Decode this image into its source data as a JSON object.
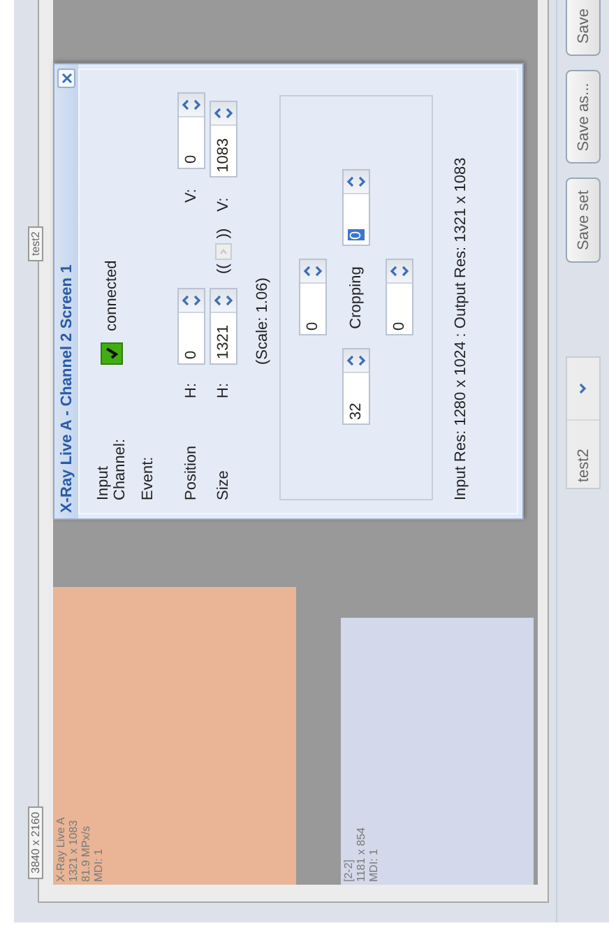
{
  "canvas_frame": {
    "size_tag": "3840 x 2160",
    "layout_tag": "test2"
  },
  "canvas": {
    "blocks": [
      {
        "lines": [
          "X-Ray Live A",
          "1321 x 1083",
          "81.9 MPx/s",
          "MDI: 1"
        ],
        "color": "#e9b596"
      },
      {
        "lines": [
          "[2-2]",
          "1181 x 854",
          "MDI: 1"
        ],
        "color": "#d3d8ea"
      }
    ]
  },
  "dialog": {
    "title": "X-Ray Live A - Channel 2 Screen 1",
    "input_channel": {
      "label": "Input Channel:",
      "status": "connected",
      "checked": true
    },
    "event": {
      "label": "Event:"
    },
    "position": {
      "label": "Position",
      "h_label": "H:",
      "h": {
        "value": "0",
        "focused": false
      },
      "v_label": "V:",
      "v": {
        "value": "0",
        "focused": false
      }
    },
    "size": {
      "label": "Size",
      "h_label": "H:",
      "h": {
        "value": "1321",
        "focused": false
      },
      "open_bracket": "((",
      "link_toggle": {
        "disabled": true
      },
      "close_bracket": "))",
      "v_label": "V:",
      "v": {
        "value": "1083",
        "focused": false
      }
    },
    "scale": "(Scale: 1.06)",
    "cropping": {
      "label": "Cropping",
      "top": {
        "value": "0",
        "focused": false
      },
      "left": {
        "value": "32",
        "focused": false
      },
      "right": {
        "value": "0",
        "focused": true
      },
      "bottom": {
        "value": "0",
        "focused": false
      }
    },
    "resolution": "Input Res: 1280 x 1024 : Output Res: 1321 x 1083"
  },
  "bottom_bar": {
    "preset": {
      "value": "test2"
    },
    "buttons": [
      "Save set",
      "Save as...",
      "Save"
    ]
  }
}
